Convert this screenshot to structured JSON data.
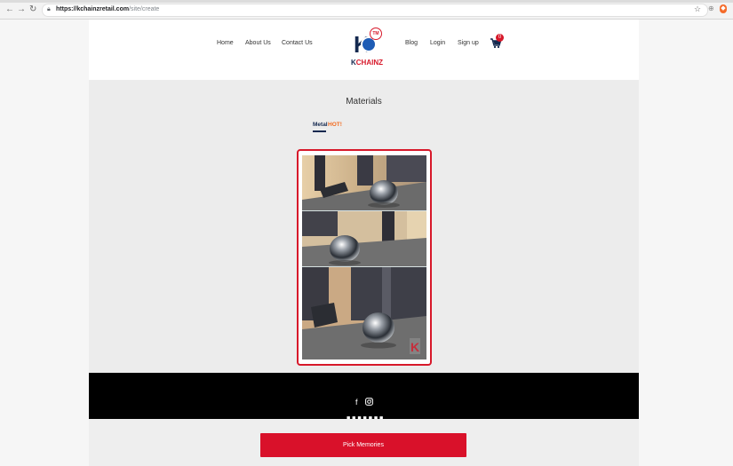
{
  "browser": {
    "url_host": "https://kchainzretail.com",
    "url_path": "/site/create"
  },
  "header": {
    "nav_left": [
      "Home",
      "About Us",
      "Contact Us"
    ],
    "nav_right": [
      "Blog",
      "Login",
      "Sign up"
    ],
    "logo_text_1": "K",
    "logo_text_2": "CHAINZ",
    "logo_tm": "TM",
    "cart_count": "0"
  },
  "main": {
    "title": "Materials",
    "tabs": [
      {
        "label": "Metal",
        "active": true,
        "badge": "HOT!"
      }
    ]
  },
  "footer": {
    "social": [
      "facebook-icon",
      "instagram-icon"
    ]
  },
  "actions": {
    "pick_label": "Pick Memories"
  },
  "colors": {
    "accent_red": "#d9112a",
    "brand_navy": "#14294f",
    "hot_orange": "#f26b1f"
  }
}
